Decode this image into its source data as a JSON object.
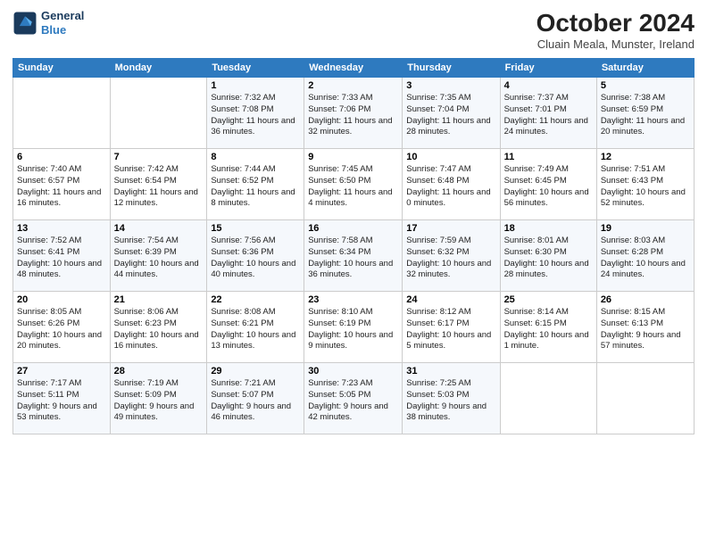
{
  "header": {
    "logo_line1": "General",
    "logo_line2": "Blue",
    "month_year": "October 2024",
    "location": "Cluain Meala, Munster, Ireland"
  },
  "weekdays": [
    "Sunday",
    "Monday",
    "Tuesday",
    "Wednesday",
    "Thursday",
    "Friday",
    "Saturday"
  ],
  "weeks": [
    [
      {
        "day": "",
        "info": ""
      },
      {
        "day": "",
        "info": ""
      },
      {
        "day": "1",
        "info": "Sunrise: 7:32 AM\nSunset: 7:08 PM\nDaylight: 11 hours and 36 minutes."
      },
      {
        "day": "2",
        "info": "Sunrise: 7:33 AM\nSunset: 7:06 PM\nDaylight: 11 hours and 32 minutes."
      },
      {
        "day": "3",
        "info": "Sunrise: 7:35 AM\nSunset: 7:04 PM\nDaylight: 11 hours and 28 minutes."
      },
      {
        "day": "4",
        "info": "Sunrise: 7:37 AM\nSunset: 7:01 PM\nDaylight: 11 hours and 24 minutes."
      },
      {
        "day": "5",
        "info": "Sunrise: 7:38 AM\nSunset: 6:59 PM\nDaylight: 11 hours and 20 minutes."
      }
    ],
    [
      {
        "day": "6",
        "info": "Sunrise: 7:40 AM\nSunset: 6:57 PM\nDaylight: 11 hours and 16 minutes."
      },
      {
        "day": "7",
        "info": "Sunrise: 7:42 AM\nSunset: 6:54 PM\nDaylight: 11 hours and 12 minutes."
      },
      {
        "day": "8",
        "info": "Sunrise: 7:44 AM\nSunset: 6:52 PM\nDaylight: 11 hours and 8 minutes."
      },
      {
        "day": "9",
        "info": "Sunrise: 7:45 AM\nSunset: 6:50 PM\nDaylight: 11 hours and 4 minutes."
      },
      {
        "day": "10",
        "info": "Sunrise: 7:47 AM\nSunset: 6:48 PM\nDaylight: 11 hours and 0 minutes."
      },
      {
        "day": "11",
        "info": "Sunrise: 7:49 AM\nSunset: 6:45 PM\nDaylight: 10 hours and 56 minutes."
      },
      {
        "day": "12",
        "info": "Sunrise: 7:51 AM\nSunset: 6:43 PM\nDaylight: 10 hours and 52 minutes."
      }
    ],
    [
      {
        "day": "13",
        "info": "Sunrise: 7:52 AM\nSunset: 6:41 PM\nDaylight: 10 hours and 48 minutes."
      },
      {
        "day": "14",
        "info": "Sunrise: 7:54 AM\nSunset: 6:39 PM\nDaylight: 10 hours and 44 minutes."
      },
      {
        "day": "15",
        "info": "Sunrise: 7:56 AM\nSunset: 6:36 PM\nDaylight: 10 hours and 40 minutes."
      },
      {
        "day": "16",
        "info": "Sunrise: 7:58 AM\nSunset: 6:34 PM\nDaylight: 10 hours and 36 minutes."
      },
      {
        "day": "17",
        "info": "Sunrise: 7:59 AM\nSunset: 6:32 PM\nDaylight: 10 hours and 32 minutes."
      },
      {
        "day": "18",
        "info": "Sunrise: 8:01 AM\nSunset: 6:30 PM\nDaylight: 10 hours and 28 minutes."
      },
      {
        "day": "19",
        "info": "Sunrise: 8:03 AM\nSunset: 6:28 PM\nDaylight: 10 hours and 24 minutes."
      }
    ],
    [
      {
        "day": "20",
        "info": "Sunrise: 8:05 AM\nSunset: 6:26 PM\nDaylight: 10 hours and 20 minutes."
      },
      {
        "day": "21",
        "info": "Sunrise: 8:06 AM\nSunset: 6:23 PM\nDaylight: 10 hours and 16 minutes."
      },
      {
        "day": "22",
        "info": "Sunrise: 8:08 AM\nSunset: 6:21 PM\nDaylight: 10 hours and 13 minutes."
      },
      {
        "day": "23",
        "info": "Sunrise: 8:10 AM\nSunset: 6:19 PM\nDaylight: 10 hours and 9 minutes."
      },
      {
        "day": "24",
        "info": "Sunrise: 8:12 AM\nSunset: 6:17 PM\nDaylight: 10 hours and 5 minutes."
      },
      {
        "day": "25",
        "info": "Sunrise: 8:14 AM\nSunset: 6:15 PM\nDaylight: 10 hours and 1 minute."
      },
      {
        "day": "26",
        "info": "Sunrise: 8:15 AM\nSunset: 6:13 PM\nDaylight: 9 hours and 57 minutes."
      }
    ],
    [
      {
        "day": "27",
        "info": "Sunrise: 7:17 AM\nSunset: 5:11 PM\nDaylight: 9 hours and 53 minutes."
      },
      {
        "day": "28",
        "info": "Sunrise: 7:19 AM\nSunset: 5:09 PM\nDaylight: 9 hours and 49 minutes."
      },
      {
        "day": "29",
        "info": "Sunrise: 7:21 AM\nSunset: 5:07 PM\nDaylight: 9 hours and 46 minutes."
      },
      {
        "day": "30",
        "info": "Sunrise: 7:23 AM\nSunset: 5:05 PM\nDaylight: 9 hours and 42 minutes."
      },
      {
        "day": "31",
        "info": "Sunrise: 7:25 AM\nSunset: 5:03 PM\nDaylight: 9 hours and 38 minutes."
      },
      {
        "day": "",
        "info": ""
      },
      {
        "day": "",
        "info": ""
      }
    ]
  ]
}
